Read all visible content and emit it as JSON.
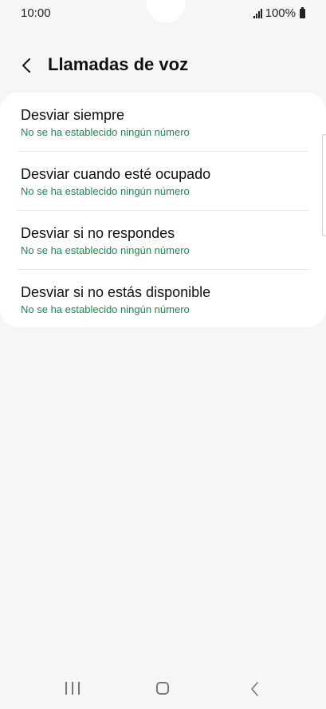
{
  "status_bar": {
    "time": "10:00",
    "battery": "100%"
  },
  "header": {
    "title": "Llamadas de voz"
  },
  "items": [
    {
      "title": "Desviar siempre",
      "subtitle": "No se ha establecido ningún número"
    },
    {
      "title": "Desviar cuando esté ocupado",
      "subtitle": "No se ha establecido ningún número"
    },
    {
      "title": "Desviar si no respondes",
      "subtitle": "No se ha establecido ningún número"
    },
    {
      "title": "Desviar si no estás disponible",
      "subtitle": "No se ha establecido ningún número"
    }
  ],
  "colors": {
    "accent_subtitle": "#1a8a48",
    "background": "#f6f6f8",
    "card": "#ffffff"
  },
  "icons": {
    "signal": "signal-icon",
    "battery": "battery-icon",
    "back": "chevron-left-icon",
    "nav_recents": "recents-icon",
    "nav_home": "home-icon",
    "nav_back": "back-icon"
  }
}
